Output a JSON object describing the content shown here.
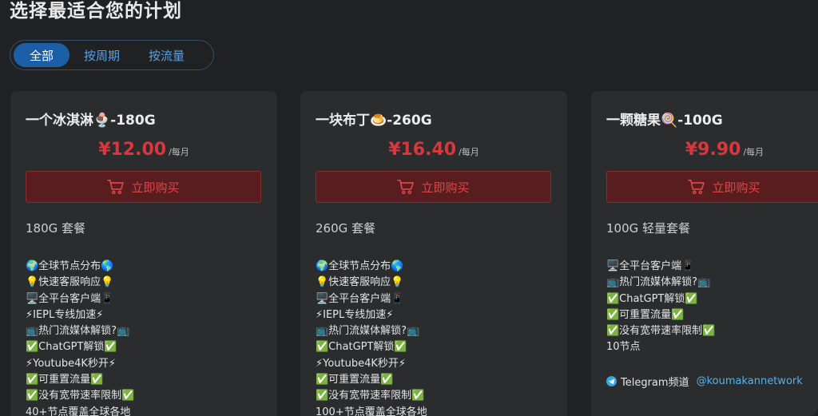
{
  "page": {
    "title": "选择最适合您的计划"
  },
  "filters": [
    {
      "label": "全部",
      "active": true
    },
    {
      "label": "按周期",
      "active": false
    },
    {
      "label": "按流量",
      "active": false
    }
  ],
  "plans": [
    {
      "title": "一个冰淇淋🍨-180G",
      "price": "¥12.00",
      "period": "/每月",
      "buy_label": "立即购买",
      "subtitle": "180G 套餐",
      "features": [
        "🌍全球节点分布🌎",
        "💡快速客服响应💡",
        "🖥️全平台客户端📱",
        "⚡IEPL专线加速⚡",
        "📺热门流媒体解锁?📺",
        "✅ChatGPT解锁✅",
        "⚡Youtube4K秒开⚡",
        "✅可重置流量✅",
        "✅没有宽带速率限制✅",
        "40+节点覆盖全球各地"
      ]
    },
    {
      "title": "一块布丁🍮-260G",
      "price": "¥16.40",
      "period": "/每月",
      "buy_label": "立即购买",
      "subtitle": "260G 套餐",
      "features": [
        "🌍全球节点分布🌎",
        "💡快速客服响应💡",
        "🖥️全平台客户端📱",
        "⚡IEPL专线加速⚡",
        "📺热门流媒体解锁?📺",
        "✅ChatGPT解锁✅",
        "⚡Youtube4K秒开⚡",
        "✅可重置流量✅",
        "✅没有宽带速率限制✅",
        "100+节点覆盖全球各地"
      ]
    },
    {
      "title": "一颗糖果🍭-100G",
      "price": "¥9.90",
      "period": "/每月",
      "buy_label": "立即购买",
      "subtitle": "100G 轻量套餐",
      "features": [
        "🖥️全平台客户端📱",
        "📺热门流媒体解锁?📺",
        "✅ChatGPT解锁✅",
        "✅可重置流量✅",
        "✅没有宽带速率限制✅",
        "10节点"
      ],
      "telegram": {
        "label": "Telegram频道",
        "handle": "@koumakannetwork"
      }
    }
  ],
  "colors": {
    "price": "#d9363e",
    "accent": "#1d5fa6",
    "link": "#5ab0e8"
  }
}
